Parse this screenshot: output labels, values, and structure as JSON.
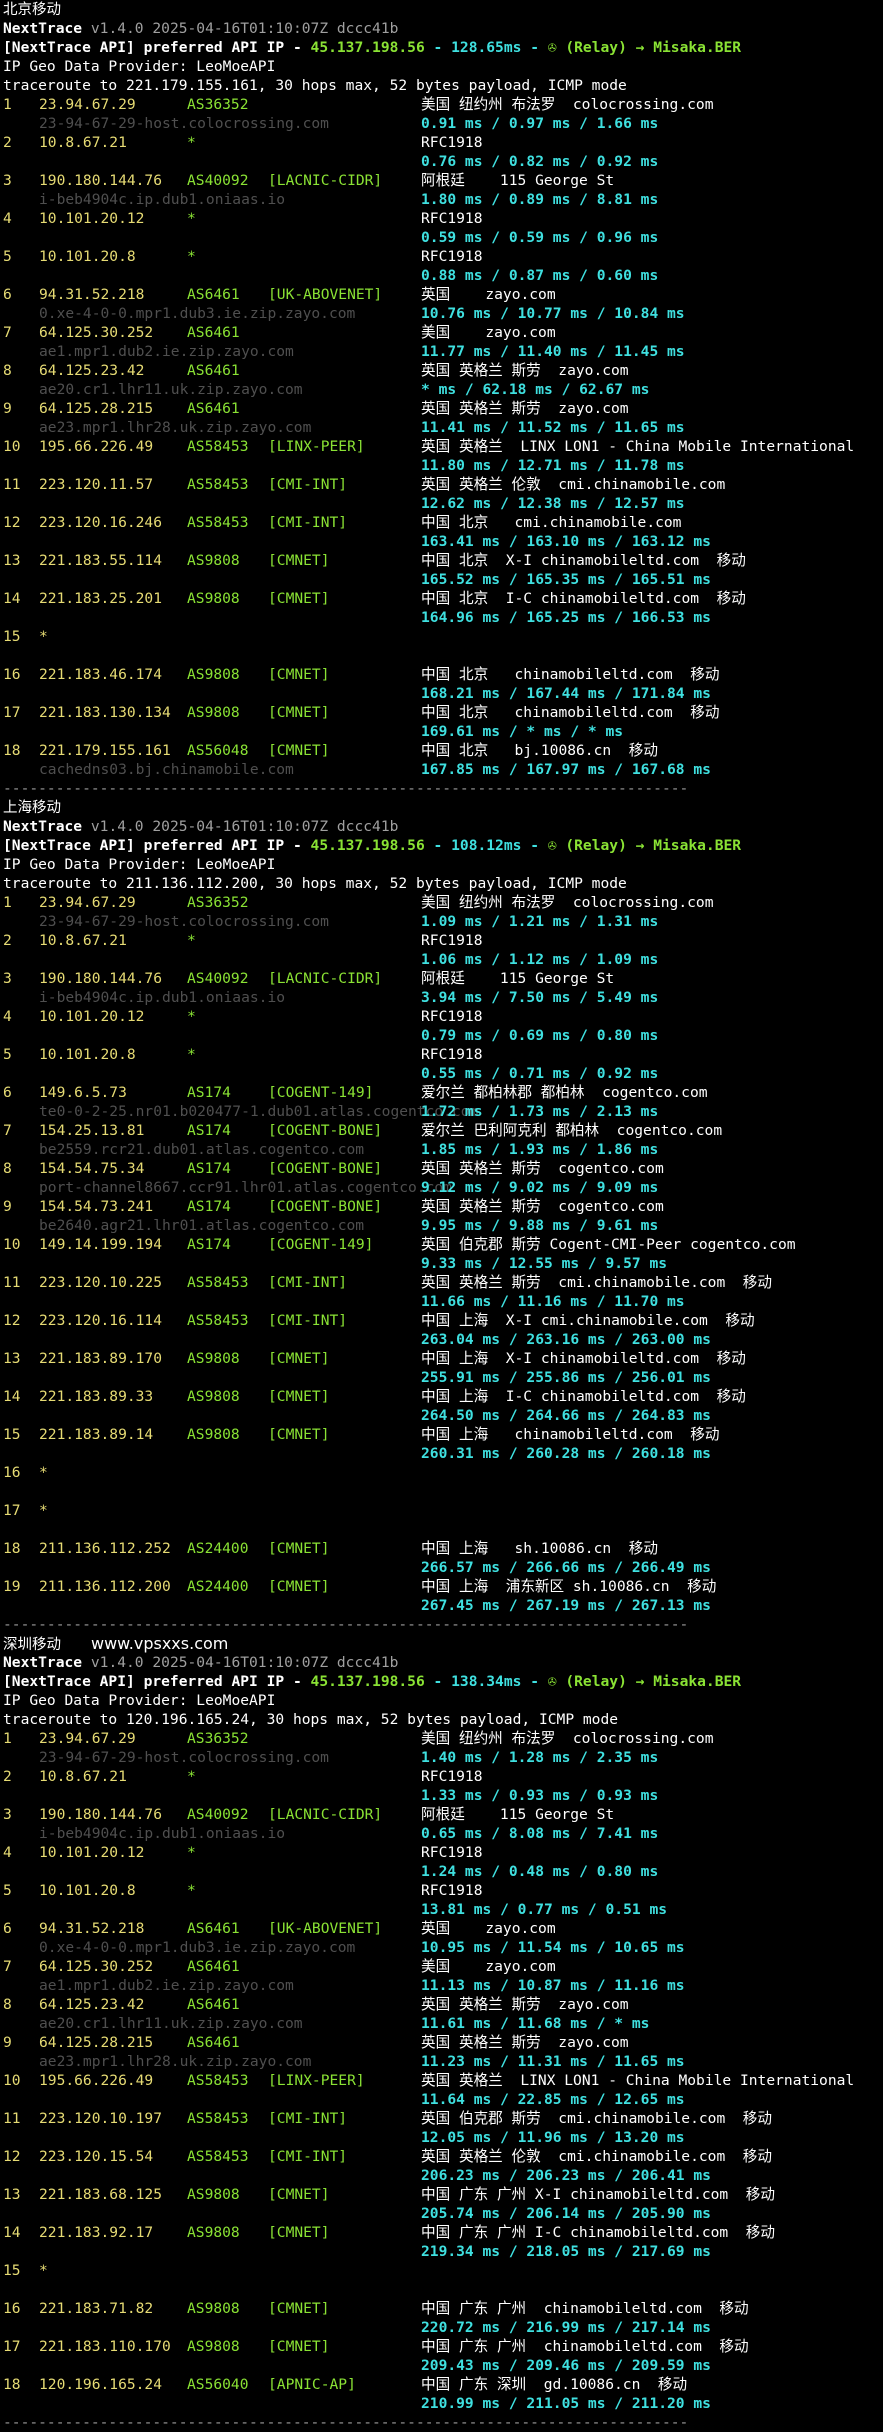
{
  "sections": [
    {
      "title": "北京移动",
      "header": {
        "name": "NextTrace",
        "version": "v1.4.0 2025-04-16T01:10:07Z dccc41b",
        "api_prefix": "[NextTrace API] preferred API IP - ",
        "api_ip": "45.137.198.56",
        "api_latency": " - 128.65ms - ",
        "api_relay": "✇ (Relay) → Misaka.BER",
        "geo_provider": "IP Geo Data Provider: LeoMoeAPI",
        "traceroute": "traceroute to 221.179.155.161, 30 hops max, 52 bytes payload, ICMP mode"
      },
      "hops": [
        {
          "num": "1",
          "ip": "23.94.67.29",
          "asn": "AS36352",
          "tag": "",
          "geo": "美国 纽约州 布法罗  colocrossing.com",
          "host": "23-94-67-29-host.colocrossing.com",
          "rtt": "0.91 ms / 0.97 ms / 1.66 ms"
        },
        {
          "num": "2",
          "ip": "10.8.67.21",
          "asn": "*",
          "tag": "",
          "geo": "RFC1918",
          "host": "",
          "rtt": "0.76 ms / 0.82 ms / 0.92 ms"
        },
        {
          "num": "3",
          "ip": "190.180.144.76",
          "asn": "AS40092",
          "tag": "[LACNIC-CIDR]",
          "geo": "阿根廷    115 George St",
          "host": "i-beb4904c.ip.dub1.oniaas.io",
          "rtt": "1.80 ms / 0.89 ms / 8.81 ms"
        },
        {
          "num": "4",
          "ip": "10.101.20.12",
          "asn": "*",
          "tag": "",
          "geo": "RFC1918",
          "host": "",
          "rtt": "0.59 ms / 0.59 ms / 0.96 ms"
        },
        {
          "num": "5",
          "ip": "10.101.20.8",
          "asn": "*",
          "tag": "",
          "geo": "RFC1918",
          "host": "",
          "rtt": "0.88 ms / 0.87 ms / 0.60 ms"
        },
        {
          "num": "6",
          "ip": "94.31.52.218",
          "asn": "AS6461",
          "tag": "[UK-ABOVENET]",
          "geo": "英国    zayo.com",
          "host": "0.xe-4-0-0.mpr1.dub3.ie.zip.zayo.com",
          "rtt": "10.76 ms / 10.77 ms / 10.84 ms"
        },
        {
          "num": "7",
          "ip": "64.125.30.252",
          "asn": "AS6461",
          "tag": "",
          "geo": "美国    zayo.com",
          "host": "ae1.mpr1.dub2.ie.zip.zayo.com",
          "rtt": "11.77 ms / 11.40 ms / 11.45 ms"
        },
        {
          "num": "8",
          "ip": "64.125.23.42",
          "asn": "AS6461",
          "tag": "",
          "geo": "英国 英格兰 斯劳  zayo.com",
          "host": "ae20.cr1.lhr11.uk.zip.zayo.com",
          "rtt": "* ms / 62.18 ms / 62.67 ms"
        },
        {
          "num": "9",
          "ip": "64.125.28.215",
          "asn": "AS6461",
          "tag": "",
          "geo": "英国 英格兰 斯劳  zayo.com",
          "host": "ae23.mpr1.lhr28.uk.zip.zayo.com",
          "rtt": "11.41 ms / 11.52 ms / 11.65 ms"
        },
        {
          "num": "10",
          "ip": "195.66.226.49",
          "asn": "AS58453",
          "tag": "[LINX-PEER]",
          "geo": "英国 英格兰  LINX LON1 - China Mobile International",
          "host": "",
          "rtt": "11.80 ms / 12.71 ms / 11.78 ms"
        },
        {
          "num": "11",
          "ip": "223.120.11.57",
          "asn": "AS58453",
          "tag": "[CMI-INT]",
          "geo": "英国 英格兰 伦敦  cmi.chinamobile.com",
          "host": "",
          "rtt": "12.62 ms / 12.38 ms / 12.57 ms"
        },
        {
          "num": "12",
          "ip": "223.120.16.246",
          "asn": "AS58453",
          "tag": "[CMI-INT]",
          "geo": "中国 北京   cmi.chinamobile.com",
          "host": "",
          "rtt": "163.41 ms / 163.10 ms / 163.12 ms"
        },
        {
          "num": "13",
          "ip": "221.183.55.114",
          "asn": "AS9808",
          "tag": "[CMNET]",
          "geo": "中国 北京  X-I chinamobileltd.com  移动",
          "host": "",
          "rtt": "165.52 ms / 165.35 ms / 165.51 ms"
        },
        {
          "num": "14",
          "ip": "221.183.25.201",
          "asn": "AS9808",
          "tag": "[CMNET]",
          "geo": "中国 北京  I-C chinamobileltd.com  移动",
          "host": "",
          "rtt": "164.96 ms / 165.25 ms / 166.53 ms"
        },
        {
          "num": "15",
          "ip": "*",
          "asn": "",
          "tag": "",
          "geo": "",
          "host": "",
          "rtt": ""
        },
        {
          "num": "16",
          "ip": "221.183.46.174",
          "asn": "AS9808",
          "tag": "[CMNET]",
          "geo": "中国 北京   chinamobileltd.com  移动",
          "host": "",
          "rtt": "168.21 ms / 167.44 ms / 171.84 ms"
        },
        {
          "num": "17",
          "ip": "221.183.130.134",
          "asn": "AS9808",
          "tag": "[CMNET]",
          "geo": "中国 北京   chinamobileltd.com  移动",
          "host": "",
          "rtt": "169.61 ms / * ms / * ms"
        },
        {
          "num": "18",
          "ip": "221.179.155.161",
          "asn": "AS56048",
          "tag": "[CMNET]",
          "geo": "中国 北京   bj.10086.cn  移动",
          "host": "cachedns03.bj.chinamobile.com",
          "rtt": "167.85 ms / 167.97 ms / 167.68 ms"
        }
      ]
    },
    {
      "title": "上海移动",
      "header": {
        "name": "NextTrace",
        "version": "v1.4.0 2025-04-16T01:10:07Z dccc41b",
        "api_prefix": "[NextTrace API] preferred API IP - ",
        "api_ip": "45.137.198.56",
        "api_latency": " - 108.12ms - ",
        "api_relay": "✇ (Relay) → Misaka.BER",
        "geo_provider": "IP Geo Data Provider: LeoMoeAPI",
        "traceroute": "traceroute to 211.136.112.200, 30 hops max, 52 bytes payload, ICMP mode"
      },
      "hops": [
        {
          "num": "1",
          "ip": "23.94.67.29",
          "asn": "AS36352",
          "tag": "",
          "geo": "美国 纽约州 布法罗  colocrossing.com",
          "host": "23-94-67-29-host.colocrossing.com",
          "rtt": "1.09 ms / 1.21 ms / 1.31 ms"
        },
        {
          "num": "2",
          "ip": "10.8.67.21",
          "asn": "*",
          "tag": "",
          "geo": "RFC1918",
          "host": "",
          "rtt": "1.06 ms / 1.12 ms / 1.09 ms"
        },
        {
          "num": "3",
          "ip": "190.180.144.76",
          "asn": "AS40092",
          "tag": "[LACNIC-CIDR]",
          "geo": "阿根廷    115 George St",
          "host": "i-beb4904c.ip.dub1.oniaas.io",
          "rtt": "3.94 ms / 7.50 ms / 5.49 ms"
        },
        {
          "num": "4",
          "ip": "10.101.20.12",
          "asn": "*",
          "tag": "",
          "geo": "RFC1918",
          "host": "",
          "rtt": "0.79 ms / 0.69 ms / 0.80 ms"
        },
        {
          "num": "5",
          "ip": "10.101.20.8",
          "asn": "*",
          "tag": "",
          "geo": "RFC1918",
          "host": "",
          "rtt": "0.55 ms / 0.71 ms / 0.92 ms"
        },
        {
          "num": "6",
          "ip": "149.6.5.73",
          "asn": "AS174",
          "tag": "[COGENT-149]",
          "geo": "爱尔兰 都柏林郡 都柏林  cogentco.com",
          "host": "te0-0-2-25.nr01.b020477-1.dub01.atlas.cogentco.com",
          "rtt": "1.72 ms / 1.73 ms / 2.13 ms"
        },
        {
          "num": "7",
          "ip": "154.25.13.81",
          "asn": "AS174",
          "tag": "[COGENT-BONE]",
          "geo": "爱尔兰 巴利阿克利 都柏林  cogentco.com",
          "host": "be2559.rcr21.dub01.atlas.cogentco.com",
          "rtt": "1.85 ms / 1.93 ms / 1.86 ms"
        },
        {
          "num": "8",
          "ip": "154.54.75.34",
          "asn": "AS174",
          "tag": "[COGENT-BONE]",
          "geo": "英国 英格兰 斯劳  cogentco.com",
          "host": "port-channel8667.ccr91.lhr01.atlas.cogentco.com",
          "rtt": "9.12 ms / 9.02 ms / 9.09 ms"
        },
        {
          "num": "9",
          "ip": "154.54.73.241",
          "asn": "AS174",
          "tag": "[COGENT-BONE]",
          "geo": "英国 英格兰 斯劳  cogentco.com",
          "host": "be2640.agr21.lhr01.atlas.cogentco.com",
          "rtt": "9.95 ms / 9.88 ms / 9.61 ms"
        },
        {
          "num": "10",
          "ip": "149.14.199.194",
          "asn": "AS174",
          "tag": "[COGENT-149]",
          "geo": "英国 伯克郡 斯劳 Cogent-CMI-Peer cogentco.com",
          "host": "",
          "rtt": "9.33 ms / 12.55 ms / 9.57 ms"
        },
        {
          "num": "11",
          "ip": "223.120.10.225",
          "asn": "AS58453",
          "tag": "[CMI-INT]",
          "geo": "英国 英格兰 斯劳  cmi.chinamobile.com  移动",
          "host": "",
          "rtt": "11.66 ms / 11.16 ms / 11.70 ms"
        },
        {
          "num": "12",
          "ip": "223.120.16.114",
          "asn": "AS58453",
          "tag": "[CMI-INT]",
          "geo": "中国 上海  X-I cmi.chinamobile.com  移动",
          "host": "",
          "rtt": "263.04 ms / 263.16 ms / 263.00 ms"
        },
        {
          "num": "13",
          "ip": "221.183.89.170",
          "asn": "AS9808",
          "tag": "[CMNET]",
          "geo": "中国 上海  X-I chinamobileltd.com  移动",
          "host": "",
          "rtt": "255.91 ms / 255.86 ms / 256.01 ms"
        },
        {
          "num": "14",
          "ip": "221.183.89.33",
          "asn": "AS9808",
          "tag": "[CMNET]",
          "geo": "中国 上海  I-C chinamobileltd.com  移动",
          "host": "",
          "rtt": "264.50 ms / 264.66 ms / 264.83 ms"
        },
        {
          "num": "15",
          "ip": "221.183.89.14",
          "asn": "AS9808",
          "tag": "[CMNET]",
          "geo": "中国 上海   chinamobileltd.com  移动",
          "host": "",
          "rtt": "260.31 ms / 260.28 ms / 260.18 ms"
        },
        {
          "num": "16",
          "ip": "*",
          "asn": "",
          "tag": "",
          "geo": "",
          "host": "",
          "rtt": ""
        },
        {
          "num": "17",
          "ip": "*",
          "asn": "",
          "tag": "",
          "geo": "",
          "host": "",
          "rtt": ""
        },
        {
          "num": "18",
          "ip": "211.136.112.252",
          "asn": "AS24400",
          "tag": "[CMNET]",
          "geo": "中国 上海   sh.10086.cn  移动",
          "host": "",
          "rtt": "266.57 ms / 266.66 ms / 266.49 ms"
        },
        {
          "num": "19",
          "ip": "211.136.112.200",
          "asn": "AS24400",
          "tag": "[CMNET]",
          "geo": "中国 上海  浦东新区 sh.10086.cn  移动",
          "host": "",
          "rtt": "267.45 ms / 267.19 ms / 267.13 ms"
        }
      ]
    },
    {
      "title": "深圳移动",
      "watermark": "www.vpsxxs.com",
      "header": {
        "name": "NextTrace",
        "version": "v1.4.0 2025-04-16T01:10:07Z dccc41b",
        "api_prefix": "[NextTrace API] preferred API IP - ",
        "api_ip": "45.137.198.56",
        "api_latency": " - 138.34ms - ",
        "api_relay": "✇ (Relay) → Misaka.BER",
        "geo_provider": "IP Geo Data Provider: LeoMoeAPI",
        "traceroute": "traceroute to 120.196.165.24, 30 hops max, 52 bytes payload, ICMP mode"
      },
      "hops": [
        {
          "num": "1",
          "ip": "23.94.67.29",
          "asn": "AS36352",
          "tag": "",
          "geo": "美国 纽约州 布法罗  colocrossing.com",
          "host": "23-94-67-29-host.colocrossing.com",
          "rtt": "1.40 ms / 1.28 ms / 2.35 ms"
        },
        {
          "num": "2",
          "ip": "10.8.67.21",
          "asn": "*",
          "tag": "",
          "geo": "RFC1918",
          "host": "",
          "rtt": "1.33 ms / 0.93 ms / 0.93 ms"
        },
        {
          "num": "3",
          "ip": "190.180.144.76",
          "asn": "AS40092",
          "tag": "[LACNIC-CIDR]",
          "geo": "阿根廷    115 George St",
          "host": "i-beb4904c.ip.dub1.oniaas.io",
          "rtt": "0.65 ms / 8.08 ms / 7.41 ms"
        },
        {
          "num": "4",
          "ip": "10.101.20.12",
          "asn": "*",
          "tag": "",
          "geo": "RFC1918",
          "host": "",
          "rtt": "1.24 ms / 0.48 ms / 0.80 ms"
        },
        {
          "num": "5",
          "ip": "10.101.20.8",
          "asn": "*",
          "tag": "",
          "geo": "RFC1918",
          "host": "",
          "rtt": "13.81 ms / 0.77 ms / 0.51 ms"
        },
        {
          "num": "6",
          "ip": "94.31.52.218",
          "asn": "AS6461",
          "tag": "[UK-ABOVENET]",
          "geo": "英国    zayo.com",
          "host": "0.xe-4-0-0.mpr1.dub3.ie.zip.zayo.com",
          "rtt": "10.95 ms / 11.54 ms / 10.65 ms"
        },
        {
          "num": "7",
          "ip": "64.125.30.252",
          "asn": "AS6461",
          "tag": "",
          "geo": "美国    zayo.com",
          "host": "ae1.mpr1.dub2.ie.zip.zayo.com",
          "rtt": "11.13 ms / 10.87 ms / 11.16 ms"
        },
        {
          "num": "8",
          "ip": "64.125.23.42",
          "asn": "AS6461",
          "tag": "",
          "geo": "英国 英格兰 斯劳  zayo.com",
          "host": "ae20.cr1.lhr11.uk.zip.zayo.com",
          "rtt": "11.61 ms / 11.68 ms / * ms"
        },
        {
          "num": "9",
          "ip": "64.125.28.215",
          "asn": "AS6461",
          "tag": "",
          "geo": "英国 英格兰 斯劳  zayo.com",
          "host": "ae23.mpr1.lhr28.uk.zip.zayo.com",
          "rtt": "11.23 ms / 11.31 ms / 11.65 ms"
        },
        {
          "num": "10",
          "ip": "195.66.226.49",
          "asn": "AS58453",
          "tag": "[LINX-PEER]",
          "geo": "英国 英格兰  LINX LON1 - China Mobile International",
          "host": "",
          "rtt": "11.64 ms / 22.85 ms / 12.65 ms"
        },
        {
          "num": "11",
          "ip": "223.120.10.197",
          "asn": "AS58453",
          "tag": "[CMI-INT]",
          "geo": "英国 伯克郡 斯劳  cmi.chinamobile.com  移动",
          "host": "",
          "rtt": "12.05 ms / 11.96 ms / 13.20 ms"
        },
        {
          "num": "12",
          "ip": "223.120.15.54",
          "asn": "AS58453",
          "tag": "[CMI-INT]",
          "geo": "英国 英格兰 伦敦  cmi.chinamobile.com  移动",
          "host": "",
          "rtt": "206.23 ms / 206.23 ms / 206.41 ms"
        },
        {
          "num": "13",
          "ip": "221.183.68.125",
          "asn": "AS9808",
          "tag": "[CMNET]",
          "geo": "中国 广东 广州 X-I chinamobileltd.com  移动",
          "host": "",
          "rtt": "205.74 ms / 206.14 ms / 205.90 ms"
        },
        {
          "num": "14",
          "ip": "221.183.92.17",
          "asn": "AS9808",
          "tag": "[CMNET]",
          "geo": "中国 广东 广州 I-C chinamobileltd.com  移动",
          "host": "",
          "rtt": "219.34 ms / 218.05 ms / 217.69 ms"
        },
        {
          "num": "15",
          "ip": "*",
          "asn": "",
          "tag": "",
          "geo": "",
          "host": "",
          "rtt": ""
        },
        {
          "num": "16",
          "ip": "221.183.71.82",
          "asn": "AS9808",
          "tag": "[CMNET]",
          "geo": "中国 广东 广州  chinamobileltd.com  移动",
          "host": "",
          "rtt": "220.72 ms / 216.99 ms / 217.14 ms"
        },
        {
          "num": "17",
          "ip": "221.183.110.170",
          "asn": "AS9808",
          "tag": "[CMNET]",
          "geo": "中国 广东 广州  chinamobileltd.com  移动",
          "host": "",
          "rtt": "209.43 ms / 209.46 ms / 209.59 ms"
        },
        {
          "num": "18",
          "ip": "120.196.165.24",
          "asn": "AS56040",
          "tag": "[APNIC-AP]",
          "geo": "中国 广东 深圳  gd.10086.cn  移动",
          "host": "",
          "rtt": "210.99 ms / 211.05 ms / 211.20 ms"
        }
      ]
    }
  ],
  "separator": "------------------------------------------------------------------------------"
}
